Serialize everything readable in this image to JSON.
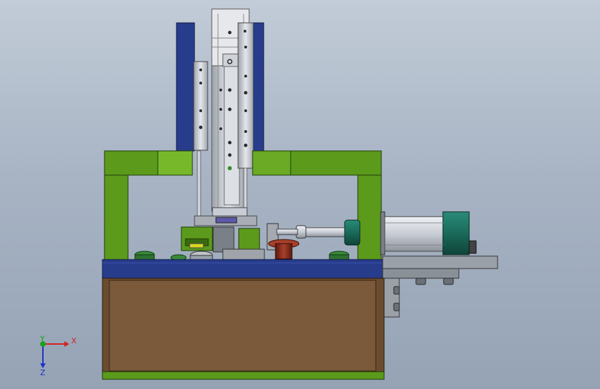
{
  "axis_triad": {
    "x_label": "X",
    "y_label": "Y",
    "z_label": "Z",
    "x_color": "#d42020",
    "y_color": "#1aa21a",
    "z_color": "#2030c8"
  },
  "colors": {
    "frame_green": "#5c9a1c",
    "frame_green_light": "#76b82a",
    "base_blue": "#283c8c",
    "cabinet_brown": "#7a5a3a",
    "cylinder_silver": "#c8ccd4",
    "cylinder_teal": "#1a6a5a",
    "pedestal_red": "#8a2a1a",
    "plate_gray": "#9aa0a8"
  }
}
